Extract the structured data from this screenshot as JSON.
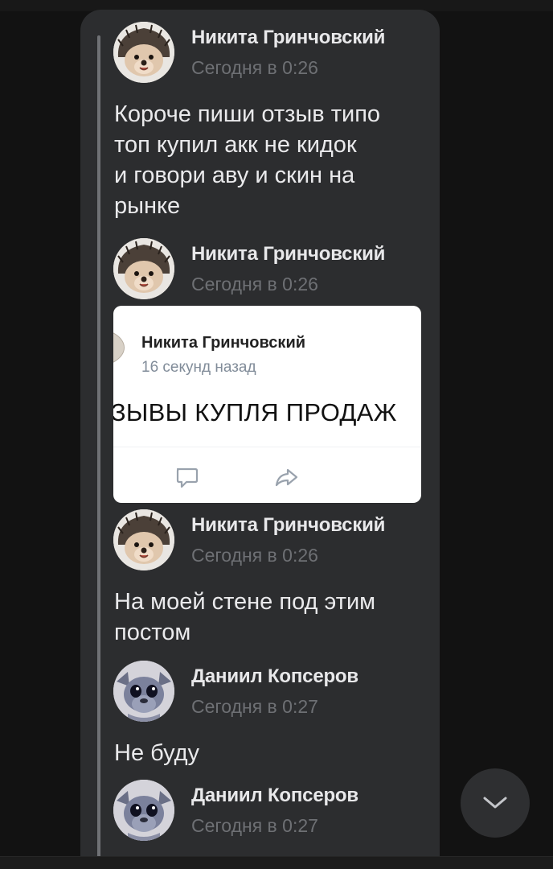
{
  "messages": [
    {
      "author": "Никита Гринчовский",
      "time": "Сегодня в 0:26",
      "avatar": "hedgehog-avatar",
      "lines": [
        "Короче пиши отзыв типо",
        "топ купил акк не кидок",
        "и говори аву и скин на",
        "рынке"
      ]
    },
    {
      "author": "Никита Гринчовский",
      "time": "Сегодня в 0:26",
      "avatar": "hedgehog-avatar",
      "attachment": {
        "author": "Никита Гринчовский",
        "time": "16 секунд назад",
        "title": "ТЗЫВЫ КУПЛЯ ПРОДАЖ",
        "actions": [
          "comment-icon",
          "share-icon"
        ]
      }
    },
    {
      "author": "Никита Гринчовский",
      "time": "Сегодня в 0:26",
      "avatar": "hedgehog-avatar",
      "lines": [
        "На моей стене под этим",
        "постом"
      ]
    },
    {
      "author": "Даниил Копсеров",
      "time": "Сегодня в 0:27",
      "avatar": "stitch-avatar",
      "lines": [
        "Не буду"
      ]
    },
    {
      "author": "Даниил Копсеров",
      "time": "Сегодня в 0:27",
      "avatar": "stitch-avatar"
    }
  ],
  "scroll_button": {
    "icon": "chevron-down-icon"
  },
  "colors": {
    "background": "#121212",
    "bubble": "#2c2d2f",
    "quote_bar": "#6f7175",
    "muted_text": "#6e7074"
  }
}
